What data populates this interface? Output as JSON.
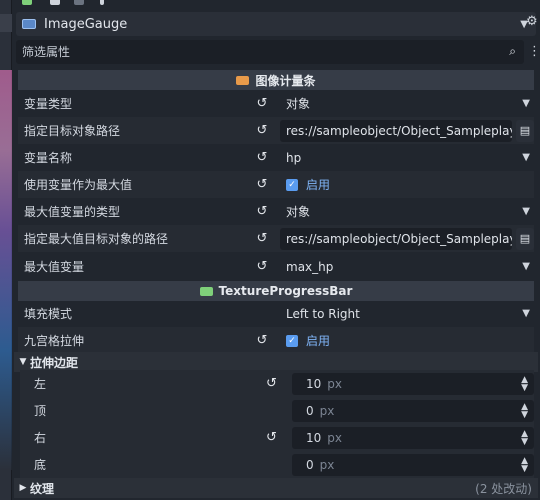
{
  "node_selector": {
    "name": "ImageGauge"
  },
  "filter": {
    "placeholder": "筛选属性"
  },
  "sections": {
    "image_gauge": {
      "title": "图像计量条"
    },
    "texture_progress_bar": {
      "title": "TextureProgressBar"
    }
  },
  "props": {
    "var_type": {
      "label": "变量类型",
      "value": "对象"
    },
    "target_path": {
      "label": "指定目标对象路径",
      "value": "res://sampleobject/Object_Sampleplayer.tscn"
    },
    "var_name": {
      "label": "变量名称",
      "value": "hp"
    },
    "use_max": {
      "label": "使用变量作为最大值",
      "value": "启用"
    },
    "max_type": {
      "label": "最大值变量的类型",
      "value": "对象"
    },
    "max_path": {
      "label": "指定最大值目标对象的路径",
      "value": "res://sampleobject/Object_Sampleplayer.tscn"
    },
    "max_var": {
      "label": "最大值变量",
      "value": "max_hp"
    },
    "fill_mode": {
      "label": "填充模式",
      "value": "Left to Right"
    },
    "nine_patch": {
      "label": "九宫格拉伸",
      "value": "启用"
    }
  },
  "stretch_group": {
    "title": "拉伸边距",
    "items": [
      {
        "label": "左",
        "value": "10",
        "unit": "px"
      },
      {
        "label": "顶",
        "value": "0",
        "unit": "px"
      },
      {
        "label": "右",
        "value": "10",
        "unit": "px"
      },
      {
        "label": "底",
        "value": "0",
        "unit": "px"
      }
    ]
  },
  "texture_group": {
    "title": "纹理",
    "changed": "(2 处改动)"
  },
  "colors": {
    "accent": "#5a9cf0",
    "panel": "#21262e",
    "field": "#1b1f26"
  }
}
